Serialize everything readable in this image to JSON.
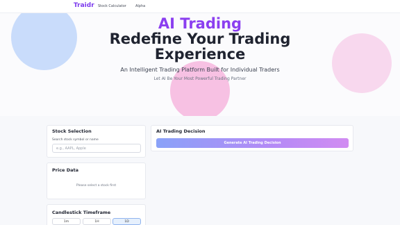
{
  "nav": {
    "brand": "Traidr",
    "links": [
      "Stock Calculator",
      "Alpha"
    ]
  },
  "hero": {
    "highlight": "AI Trading",
    "title_line1": "Redefine Your Trading",
    "title_line2": "Experience",
    "subtitle": "An Intelligent Trading Platform Built for Individual Traders",
    "tagline": "Let AI Be Your Most Powerful Trading Partner"
  },
  "stock_selection": {
    "title": "Stock Selection",
    "search_label": "Search stock symbol or name",
    "search_placeholder": "e.g., AAPL, Apple"
  },
  "price_data": {
    "title": "Price Data",
    "empty_message": "Please select a stock first"
  },
  "timeframe": {
    "title": "Candlestick Timeframe",
    "options": [
      "1m",
      "1H",
      "1D"
    ],
    "selected": "1D"
  },
  "ai_decision": {
    "title": "AI Trading Decision",
    "button_label": "Generate AI Trading Decision"
  },
  "colors": {
    "brand": "#7c3aed",
    "highlight": "#8b3ff0"
  }
}
